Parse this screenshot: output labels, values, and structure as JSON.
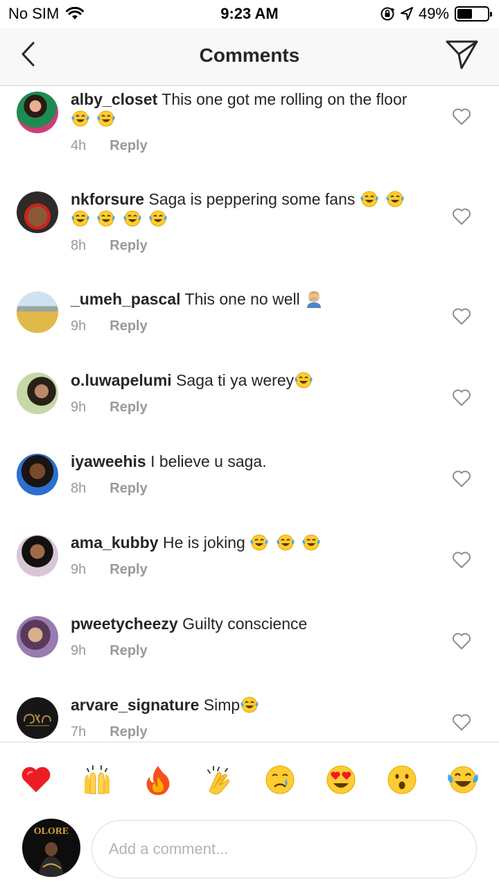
{
  "status_bar": {
    "carrier": "No SIM",
    "time": "9:23 AM",
    "battery": "49%",
    "battery_level": 0.49,
    "icons": [
      "wifi-icon",
      "orientation-lock-icon",
      "location-arrow-icon",
      "battery-icon"
    ]
  },
  "nav": {
    "title": "Comments",
    "back_icon": "chevron-left-icon",
    "send_icon": "paper-plane-icon"
  },
  "comments": [
    {
      "user": "alby_closet",
      "text": "This one got me rolling on the floor",
      "emojis": [
        "laughing-tears",
        "laughing-tears"
      ],
      "time": "4h",
      "reply": "Reply"
    },
    {
      "user": "nkforsure",
      "text": "Saga is peppering some fans",
      "emojis": [
        "laughing-tears",
        "laughing-tears",
        "laughing-tears",
        "laughing-tears",
        "laughing-tears",
        "laughing-tears"
      ],
      "time": "8h",
      "reply": "Reply"
    },
    {
      "user": "_umeh_pascal",
      "text": "This one no well",
      "emojis": [
        "facepalm"
      ],
      "time": "9h",
      "reply": "Reply"
    },
    {
      "user": "o.luwapelumi",
      "text": "Saga ti ya werey",
      "emojis": [
        "laughing-tears"
      ],
      "time": "9h",
      "reply": "Reply"
    },
    {
      "user": "iyaweehis",
      "text": "I believe u saga.",
      "emojis": [],
      "time": "8h",
      "reply": "Reply"
    },
    {
      "user": "ama_kubby",
      "text": "He is joking",
      "emojis": [
        "laughing-tears",
        "laughing-tears",
        "laughing-tears"
      ],
      "time": "9h",
      "reply": "Reply"
    },
    {
      "user": "pweetycheezy",
      "text": "Guilty conscience",
      "emojis": [],
      "time": "9h",
      "reply": "Reply"
    },
    {
      "user": "arvare_signature",
      "text": "Simp",
      "emojis": [
        "laughing-tears"
      ],
      "time": "7h",
      "reply": "Reply"
    }
  ],
  "reactions": [
    "heart",
    "raising-hands",
    "fire",
    "clapping-hands",
    "crying-face",
    "heart-eyes",
    "astonished-face",
    "laughing-tears"
  ],
  "composer": {
    "placeholder": "Add a comment...",
    "avatar_text": "OLORE"
  },
  "colors": {
    "text": "#262626",
    "meta": "#999999",
    "nav_bg": "#f8f8f8",
    "heart_red": "#ed1c24",
    "emoji_yellow": "#ffcc33"
  }
}
